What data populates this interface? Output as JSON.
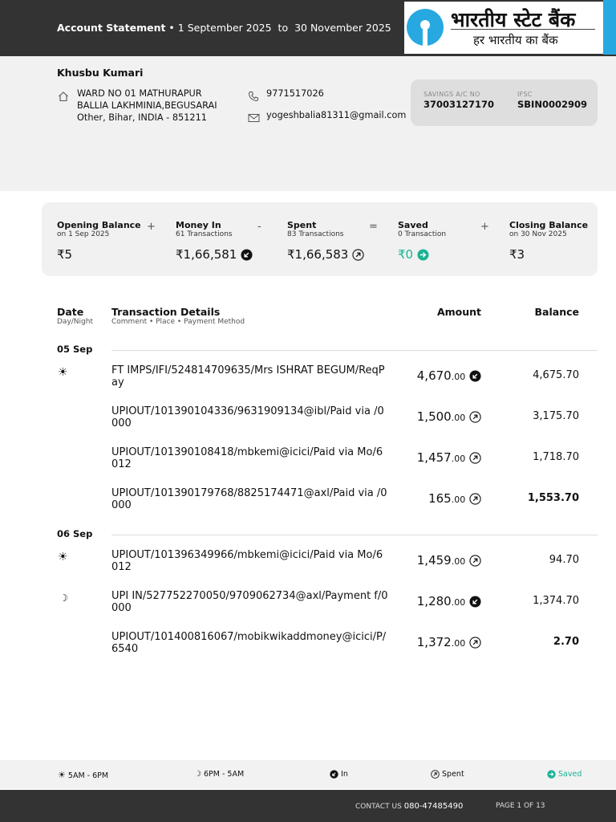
{
  "header": {
    "title": "Account Statement",
    "from": "1 September 2025",
    "sep": "to",
    "to": "30 November 2025",
    "bank_name_hindi": "भारतीय स्टेट बैंक",
    "bank_tagline_hindi": "हर भारतीय का बैंक"
  },
  "customer": {
    "name": "Khusbu Kumari",
    "address_line1": "WARD NO 01 MATHURAPUR",
    "address_line2": "BALLIA LAKHMINIA,BEGUSARAI",
    "address_line3": "Other, Bihar, INDIA - 851211",
    "phone": "9771517026",
    "email": "yogeshbalia81311@gmail.com"
  },
  "account": {
    "acc_label": "SAVINGS A/C NO",
    "acc_no": "37003127170",
    "ifsc_label": "IFSC",
    "ifsc": "SBIN0002909"
  },
  "summary": {
    "opening": {
      "title": "Opening Balance",
      "sub": "on 1 Sep 2025",
      "value": "₹5"
    },
    "money_in": {
      "title": "Money In",
      "sub": "61 Transactions",
      "value": "₹1,66,581"
    },
    "spent": {
      "title": "Spent",
      "sub": "83 Transactions",
      "value": "₹1,66,583"
    },
    "saved": {
      "title": "Saved",
      "sub": "0 Transaction",
      "value": "₹0"
    },
    "closing": {
      "title": "Closing Balance",
      "sub": "on 30 Nov 2025",
      "value": "₹3"
    },
    "ops": [
      "+",
      "-",
      "=",
      "+"
    ]
  },
  "table": {
    "col_date": "Date",
    "col_date_sub": "Day/Night",
    "col_details": "Transaction Details",
    "col_details_sub": "Comment • Place • Payment Method",
    "col_amount": "Amount",
    "col_balance": "Balance"
  },
  "groups": [
    {
      "date": "05 Sep",
      "rows": [
        {
          "time": "day",
          "details": "FT IMPS/IFI/524814709635/Mrs ISHRAT BEGUM/ReqPay",
          "amount_int": "4,670",
          "amount_dec": ".00",
          "type": "in",
          "balance": "4,675.70",
          "bold": false
        },
        {
          "time": "",
          "details": "UPIOUT/101390104336/9631909134@ibl/Paid via /0000",
          "amount_int": "1,500",
          "amount_dec": ".00",
          "type": "spent",
          "balance": "3,175.70",
          "bold": false
        },
        {
          "time": "",
          "details": "UPIOUT/101390108418/mbkemi@icici/Paid via Mo/6012",
          "amount_int": "1,457",
          "amount_dec": ".00",
          "type": "spent",
          "balance": "1,718.70",
          "bold": false
        },
        {
          "time": "",
          "details": "UPIOUT/101390179768/8825174471@axl/Paid via /0000",
          "amount_int": "165",
          "amount_dec": ".00",
          "type": "spent",
          "balance": "1,553.70",
          "bold": true
        }
      ]
    },
    {
      "date": "06 Sep",
      "rows": [
        {
          "time": "day",
          "details": "UPIOUT/101396349966/mbkemi@icici/Paid via Mo/6012",
          "amount_int": "1,459",
          "amount_dec": ".00",
          "type": "spent",
          "balance": "94.70",
          "bold": false
        },
        {
          "time": "night",
          "details": "UPI IN/527752270050/9709062734@axl/Payment f/0000",
          "amount_int": "1,280",
          "amount_dec": ".00",
          "type": "in",
          "balance": "1,374.70",
          "bold": false
        },
        {
          "time": "",
          "details": "UPIOUT/101400816067/mobikwikaddmoney@icici/P/6540",
          "amount_int": "1,372",
          "amount_dec": ".00",
          "type": "spent",
          "balance": "2.70",
          "bold": true
        }
      ]
    }
  ],
  "legend": {
    "day": "5AM - 6PM",
    "night": "6PM - 5AM",
    "in": "In",
    "spent": "Spent",
    "saved": "Saved",
    "saved_color": "#1bb394"
  },
  "footer": {
    "contact_label": "CONTACT US",
    "contact_no": "080-47485490",
    "page": "PAGE 1 OF 13"
  }
}
